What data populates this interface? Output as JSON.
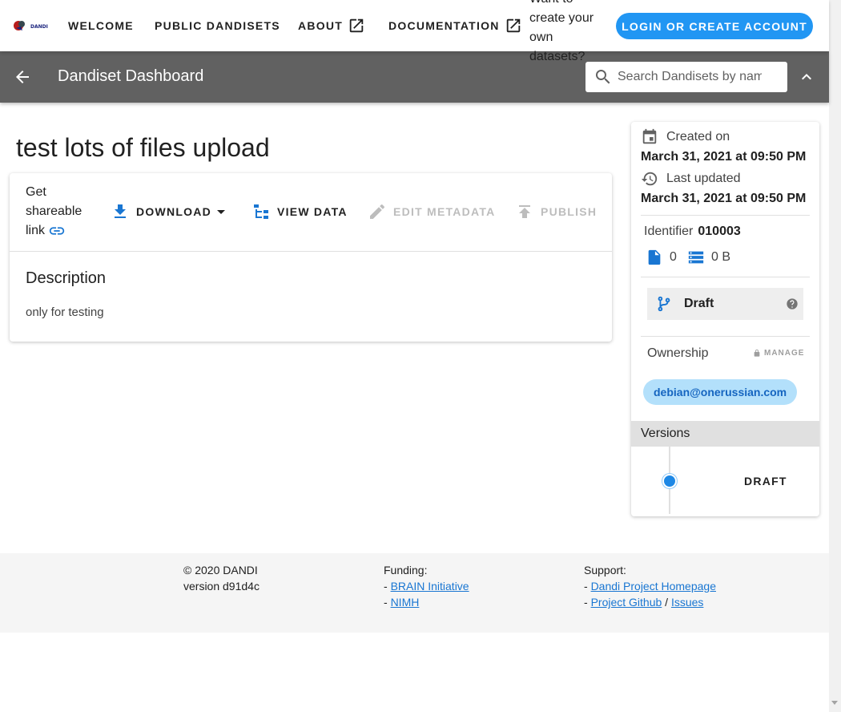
{
  "topbar": {
    "logo_text": "DANDI",
    "nav": [
      "WELCOME",
      "PUBLIC DANDISETS",
      "ABOUT",
      "DOCUMENTATION"
    ],
    "promo": "Want to create your own datasets?",
    "login_label": "LOGIN OR CREATE ACCOUNT",
    "accent_color": "#2196f3"
  },
  "toolbar": {
    "title": "Dandiset Dashboard",
    "search_placeholder": "Search Dandisets by name, description, identifier, or contributor name"
  },
  "dandiset": {
    "title": "test lots of files upload",
    "share_label": "Get shareable link",
    "actions": {
      "download": "DOWNLOAD",
      "view_data": "VIEW DATA",
      "edit_metadata": "EDIT METADATA",
      "publish": "PUBLISH"
    },
    "description_heading": "Description",
    "description": "only for testing"
  },
  "side": {
    "created_label": "Created on",
    "created_value": "March 31, 2021 at 09:50 PM",
    "updated_label": "Last updated",
    "updated_value": "March 31, 2021 at 09:50 PM",
    "identifier_label": "Identifier",
    "identifier_value": "010003",
    "file_count": "0",
    "size": "0 B",
    "version_status": "Draft",
    "ownership_label": "Ownership",
    "manage_label": "MANAGE",
    "owner": "debian@onerussian.com",
    "versions_label": "Versions",
    "version_item": "DRAFT"
  },
  "footer": {
    "copyright": "© 2020 DANDI",
    "version": "version d91d4c",
    "funding_label": "Funding:",
    "funding_links": [
      "BRAIN Initiative",
      "NIMH"
    ],
    "support_label": "Support:",
    "support_homepage": "Dandi Project Homepage",
    "support_github": "Project Github",
    "support_issues": "Issues"
  }
}
